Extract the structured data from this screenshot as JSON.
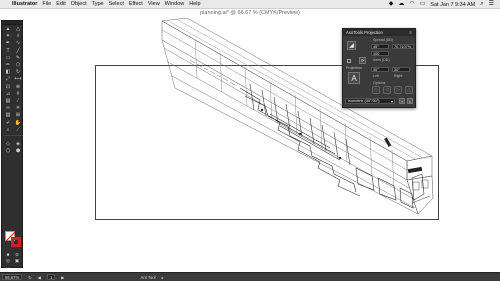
{
  "menubar": {
    "app_name": "Illustrator",
    "items": [
      "File",
      "Edit",
      "Object",
      "Type",
      "Select",
      "Effect",
      "View",
      "Window",
      "Help"
    ],
    "clock": "Sat Jan 7  9:34 AM"
  },
  "document": {
    "title": "planning.ai* @ 66.67 % (CMYK/Preview)"
  },
  "axo_panel": {
    "title": "AxoTools Projection",
    "spread_label": "Spread (DD)",
    "angle_value": "45°",
    "scale_value": "70.7107%",
    "slider_value": "100",
    "axes_label": "Axes (DD)",
    "projection_label": "Projection",
    "left_angle": "30°",
    "right_angle": "30°",
    "left_label": "Left",
    "right_label": "Right",
    "options_label": "Options",
    "preset": "Isometric (30°/30°)"
  },
  "status_bar": {
    "zoom": "66.67%",
    "artboard": "1",
    "tool": "Ant Tool"
  },
  "colors": {
    "menubar": "#e9e9e9",
    "panel": "#3a3a3a",
    "tools": "#2f2f2f",
    "stroke_swatch": "#cc2222"
  }
}
